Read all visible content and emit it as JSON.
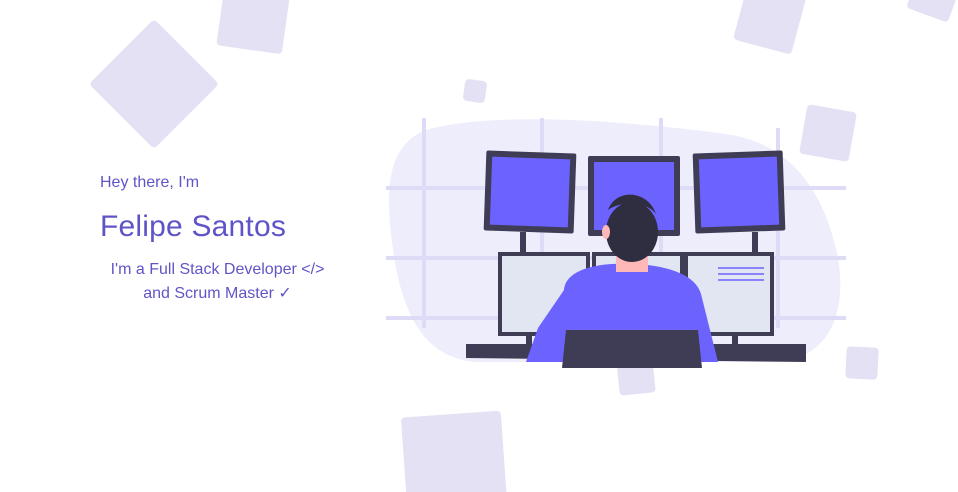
{
  "hero": {
    "greeting": "Hey there, I'm",
    "name": "Felipe Santos",
    "role_line_1": "I'm a Full Stack Developer </>",
    "role_line_2": "and Scrum Master ✓"
  },
  "illustration": {
    "name": "developer-at-monitors-illustration"
  },
  "colors": {
    "accent": "#5f55c6",
    "decor_square": "#e4e1f4",
    "blob": "#eeedfc",
    "monitor_screen": "#6c63ff",
    "monitor_frame": "#3f3d56",
    "shirt": "#6c63ff",
    "skin": "#ffb8b8",
    "hair": "#2f2e41"
  }
}
